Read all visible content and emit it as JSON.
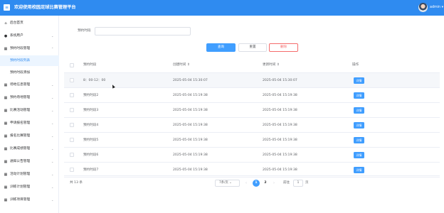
{
  "header": {
    "menu_icon": "menu-icon",
    "title": "欢迎使用校园足球比赛管理平台",
    "user": "admin"
  },
  "sidebar": {
    "items": [
      {
        "label": "后台首页",
        "icon": "home-icon",
        "expanded": false
      },
      {
        "label": "系统用户",
        "icon": "user-icon",
        "expanded": false
      },
      {
        "label": "预约时段管理",
        "icon": "grid-icon",
        "expanded": true,
        "children": [
          "预约时段列表",
          "预约时段添加"
        ]
      },
      {
        "label": "场地信息管理",
        "icon": "grid-icon"
      },
      {
        "label": "预约场地管理",
        "icon": "grid-icon"
      },
      {
        "label": "比赛活动管理",
        "icon": "grid-icon"
      },
      {
        "label": "申请报名管理",
        "icon": "grid-icon"
      },
      {
        "label": "报名比赛管理",
        "icon": "grid-icon"
      },
      {
        "label": "比赛成绩管理",
        "icon": "grid-icon"
      },
      {
        "label": "通知公告管理",
        "icon": "grid-icon"
      },
      {
        "label": "活动计划管理",
        "icon": "grid-icon"
      },
      {
        "label": "训练计划管理",
        "icon": "grid-icon"
      },
      {
        "label": "训练项目管理",
        "icon": "grid-icon"
      }
    ],
    "active_child": "预约时段列表"
  },
  "search": {
    "label": "预约时段",
    "placeholder": "",
    "value": ""
  },
  "buttons": {
    "query": "查询",
    "reset": "重置",
    "delete": "删除"
  },
  "table": {
    "columns": [
      "预约时段",
      "创建时间",
      "更新时间",
      "操作"
    ],
    "rows": [
      {
        "name": "8：00-12：00",
        "created": "2025-05-04 15:30:07",
        "updated": "2025-05-04 15:30:07",
        "action": "详情"
      },
      {
        "name": "预约时段2",
        "created": "2025-05-04 15:19:38",
        "updated": "2025-05-04 15:19:38",
        "action": "详情"
      },
      {
        "name": "预约时段3",
        "created": "2025-05-04 15:19:38",
        "updated": "2025-05-04 15:19:38",
        "action": "详情"
      },
      {
        "name": "预约时段4",
        "created": "2025-05-04 15:19:38",
        "updated": "2025-05-04 15:19:38",
        "action": "详情"
      },
      {
        "name": "预约时段5",
        "created": "2025-05-04 15:19:38",
        "updated": "2025-05-04 15:19:38",
        "action": "详情"
      },
      {
        "name": "预约时段6",
        "created": "2025-05-04 15:19:38",
        "updated": "2025-05-04 15:19:38",
        "action": "详情"
      },
      {
        "name": "预约时段7",
        "created": "2025-05-04 15:19:38",
        "updated": "2025-05-04 15:19:38",
        "action": "详情"
      }
    ]
  },
  "pagination": {
    "total": "共 13 条",
    "page_size": "7条/页",
    "pages": [
      "1",
      "2"
    ],
    "current": "1",
    "goto_label": "前往",
    "goto_value": "1",
    "goto_suffix": "页"
  },
  "colors": {
    "primary": "#2f8bf0",
    "button": "#409eff",
    "danger": "#f56c6c"
  }
}
